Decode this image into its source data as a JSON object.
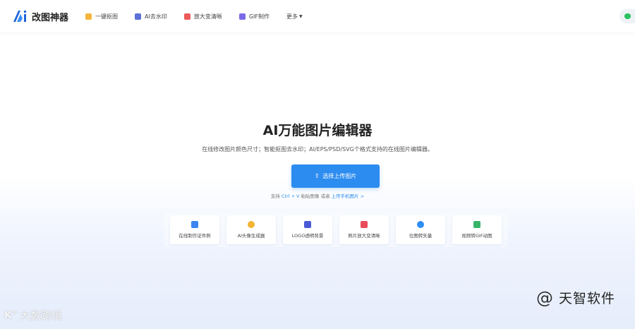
{
  "header": {
    "logo_text": "改图神器",
    "nav": [
      {
        "label": "一键抠图",
        "icon": "scissors-icon",
        "color": "#f5b53d"
      },
      {
        "label": "AI去水印",
        "icon": "eraser-icon",
        "color": "#5b6fd8"
      },
      {
        "label": "放大变清晰",
        "icon": "enlarge-icon",
        "color": "#ef5a5a"
      },
      {
        "label": "GIF制作",
        "icon": "gif-icon",
        "color": "#7a6ae6"
      },
      {
        "label": "更多"
      }
    ]
  },
  "hero": {
    "title": "AI万能图片编辑器",
    "subtitle": "在线修改图片颜色尺寸；智能抠图去水印；AI/EPS/PSD/SVG个格式支持的在线图片编辑器。",
    "upload_label": "选择上传图片",
    "hint_prefix": "支持 ",
    "hint_ctrl": "Ctrl + V",
    "hint_middle": " 粘贴图像 或者 ",
    "hint_link": "上传手机图片 >"
  },
  "tools": [
    {
      "label": "在线制作证件照",
      "icon": "id-photo-icon",
      "color": "#3b86f0"
    },
    {
      "label": "AI头像生成器",
      "icon": "avatar-generator-icon",
      "color": "#f2b431"
    },
    {
      "label": "LOGO透明背景",
      "icon": "transparent-bg-icon",
      "color": "#4a5ad6"
    },
    {
      "label": "照片放大变清晰",
      "icon": "photo-enlarge-icon",
      "color": "#e94c5b"
    },
    {
      "label": "位图转矢量",
      "icon": "vector-icon",
      "color": "#2f8ef3"
    },
    {
      "label": "视频转GIF动图",
      "icon": "video-gif-icon",
      "color": "#38b56a"
    }
  ],
  "watermarks": {
    "right": "天智软件",
    "left": "大数跨境"
  },
  "colors": {
    "accent": "#2d8cf0",
    "wechat": "#27c25f"
  }
}
